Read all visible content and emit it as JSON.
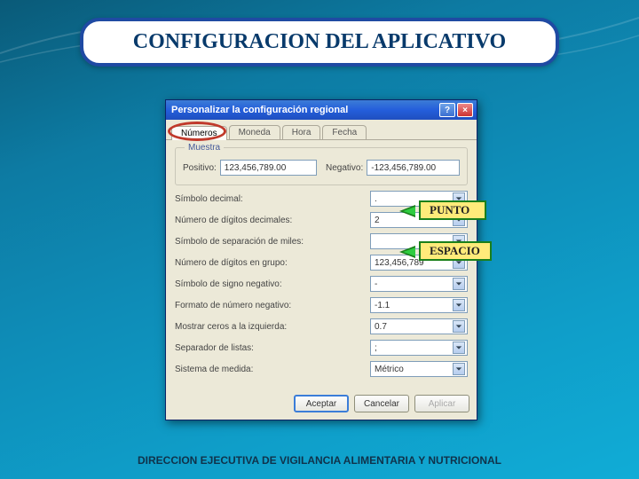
{
  "slide": {
    "title": "CONFIGURACION DEL APLICATIVO",
    "footer": "DIRECCION EJECUTIVA DE VIGILANCIA ALIMENTARIA Y NUTRICIONAL"
  },
  "dialog": {
    "title": "Personalizar la configuración regional",
    "help_btn": "?",
    "close_btn": "×",
    "tabs": {
      "numeros": "Números",
      "moneda": "Moneda",
      "hora": "Hora",
      "fecha": "Fecha"
    },
    "group_sample": "Muestra",
    "sample_pos_label": "Positivo:",
    "sample_pos_value": "123,456,789.00",
    "sample_neg_label": "Negativo:",
    "sample_neg_value": "-123,456,789.00",
    "fields": {
      "decimal_symbol": {
        "label": "Símbolo decimal:",
        "value": "."
      },
      "decimal_digits": {
        "label": "Número de dígitos decimales:",
        "value": "2"
      },
      "thousands_sep": {
        "label": "Símbolo de separación de miles:",
        "value": " "
      },
      "digit_grouping": {
        "label": "Número de dígitos en grupo:",
        "value": "123,456,789"
      },
      "neg_sign": {
        "label": "Símbolo de signo negativo:",
        "value": "-"
      },
      "neg_format": {
        "label": "Formato de número negativo:",
        "value": "-1.1"
      },
      "leading_zeros": {
        "label": "Mostrar ceros a la izquierda:",
        "value": "0.7"
      },
      "list_sep": {
        "label": "Separador de listas:",
        "value": ";"
      },
      "measure_system": {
        "label": "Sistema de medida:",
        "value": "Métrico"
      }
    },
    "buttons": {
      "accept": "Aceptar",
      "cancel": "Cancelar",
      "apply": "Aplicar"
    }
  },
  "callouts": {
    "punto": "PUNTO",
    "espacio": "ESPACIO"
  }
}
